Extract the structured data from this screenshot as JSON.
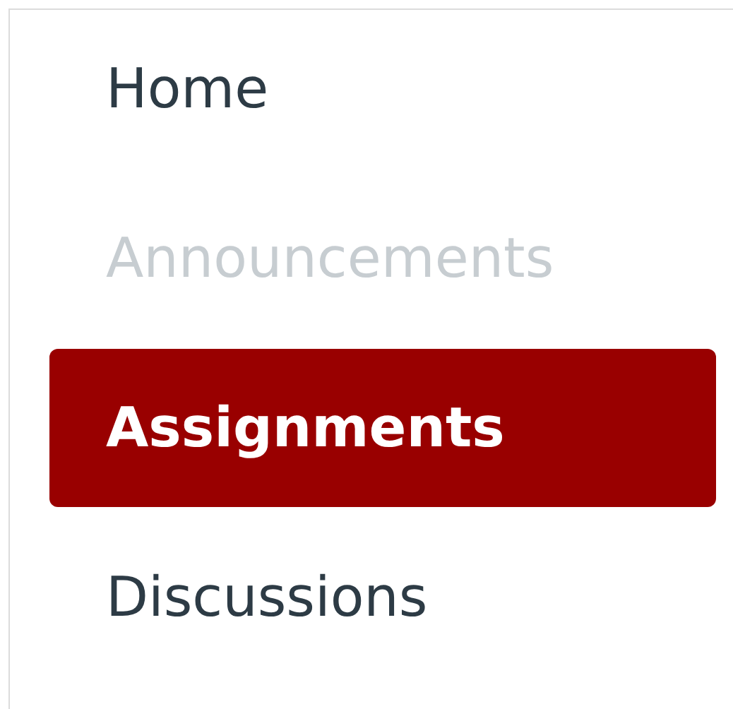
{
  "nav": {
    "items": [
      {
        "label": "Home",
        "selected": false,
        "disabled": false
      },
      {
        "label": "Announcements",
        "selected": false,
        "disabled": true
      },
      {
        "label": "Assignments",
        "selected": true,
        "disabled": false
      },
      {
        "label": "Discussions",
        "selected": false,
        "disabled": false
      }
    ]
  }
}
